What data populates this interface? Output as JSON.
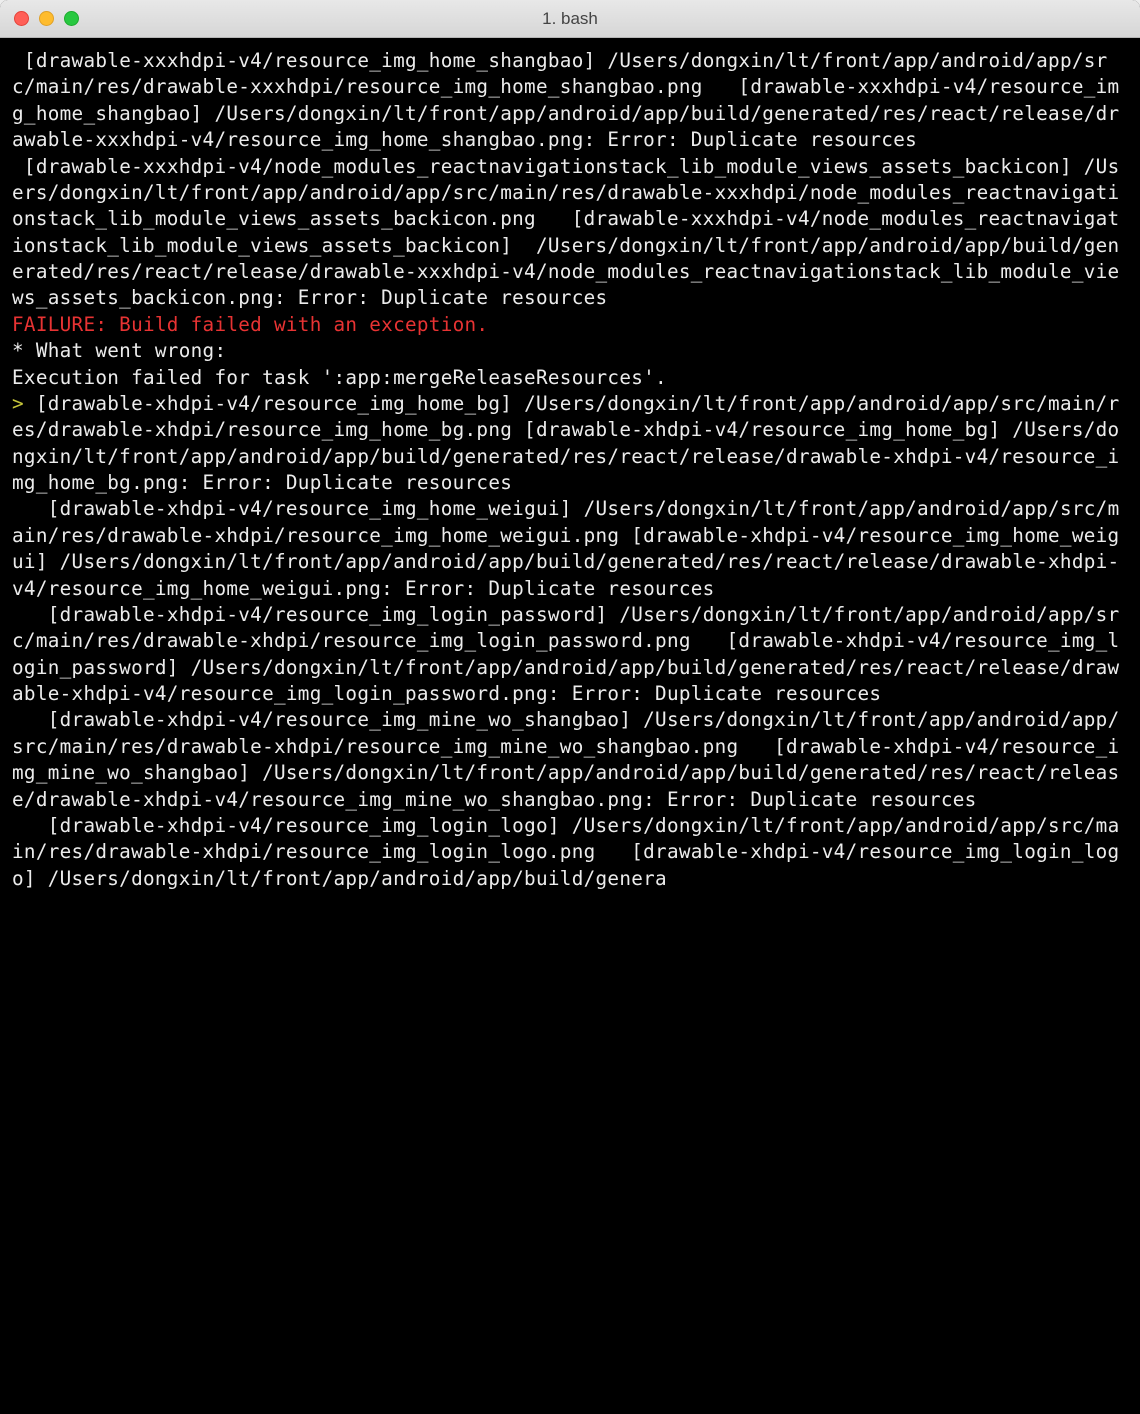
{
  "window": {
    "title": "1. bash"
  },
  "terminal": {
    "lines": [
      {
        "cls": "",
        "text": " [drawable-xxxhdpi-v4/resource_img_home_shangbao] /Users/dongxin/lt/front/app/android/app/src/main/res/drawable-xxxhdpi/resource_img_home_shangbao.png   [drawable-xxxhdpi-v4/resource_img_home_shangbao] /Users/dongxin/lt/front/app/android/app/build/generated/res/react/release/drawable-xxxhdpi-v4/resource_img_home_shangbao.png: Error: Duplicate resources"
      },
      {
        "cls": "",
        "text": " [drawable-xxxhdpi-v4/node_modules_reactnavigationstack_lib_module_views_assets_backicon] /Users/dongxin/lt/front/app/android/app/src/main/res/drawable-xxxhdpi/node_modules_reactnavigationstack_lib_module_views_assets_backicon.png   [drawable-xxxhdpi-v4/node_modules_reactnavigationstack_lib_module_views_assets_backicon]  /Users/dongxin/lt/front/app/android/app/build/generated/res/react/release/drawable-xxxhdpi-v4/node_modules_reactnavigationstack_lib_module_views_assets_backicon.png: Error: Duplicate resources"
      },
      {
        "cls": "",
        "text": ""
      },
      {
        "cls": "red",
        "text": "FAILURE: Build failed with an exception."
      },
      {
        "cls": "",
        "text": ""
      },
      {
        "cls": "",
        "text": "* What went wrong:"
      },
      {
        "cls": "",
        "text": "Execution failed for task ':app:mergeReleaseResources'."
      },
      {
        "cls": "yellow",
        "text": "> ",
        "inline": true
      },
      {
        "cls": "",
        "text": "[drawable-xhdpi-v4/resource_img_home_bg] /Users/dongxin/lt/front/app/android/app/src/main/res/drawable-xhdpi/resource_img_home_bg.png [drawable-xhdpi-v4/resource_img_home_bg] /Users/dongxin/lt/front/app/android/app/build/generated/res/react/release/drawable-xhdpi-v4/resource_img_home_bg.png: Error: Duplicate resources"
      },
      {
        "cls": "",
        "text": "   [drawable-xhdpi-v4/resource_img_home_weigui] /Users/dongxin/lt/front/app/android/app/src/main/res/drawable-xhdpi/resource_img_home_weigui.png [drawable-xhdpi-v4/resource_img_home_weigui] /Users/dongxin/lt/front/app/android/app/build/generated/res/react/release/drawable-xhdpi-v4/resource_img_home_weigui.png: Error: Duplicate resources"
      },
      {
        "cls": "",
        "text": "   [drawable-xhdpi-v4/resource_img_login_password] /Users/dongxin/lt/front/app/android/app/src/main/res/drawable-xhdpi/resource_img_login_password.png   [drawable-xhdpi-v4/resource_img_login_password] /Users/dongxin/lt/front/app/android/app/build/generated/res/react/release/drawable-xhdpi-v4/resource_img_login_password.png: Error: Duplicate resources"
      },
      {
        "cls": "",
        "text": "   [drawable-xhdpi-v4/resource_img_mine_wo_shangbao] /Users/dongxin/lt/front/app/android/app/src/main/res/drawable-xhdpi/resource_img_mine_wo_shangbao.png   [drawable-xhdpi-v4/resource_img_mine_wo_shangbao] /Users/dongxin/lt/front/app/android/app/build/generated/res/react/release/drawable-xhdpi-v4/resource_img_mine_wo_shangbao.png: Error: Duplicate resources"
      },
      {
        "cls": "",
        "text": "   [drawable-xhdpi-v4/resource_img_login_logo] /Users/dongxin/lt/front/app/android/app/src/main/res/drawable-xhdpi/resource_img_login_logo.png   [drawable-xhdpi-v4/resource_img_login_logo] /Users/dongxin/lt/front/app/android/app/build/genera"
      }
    ]
  }
}
